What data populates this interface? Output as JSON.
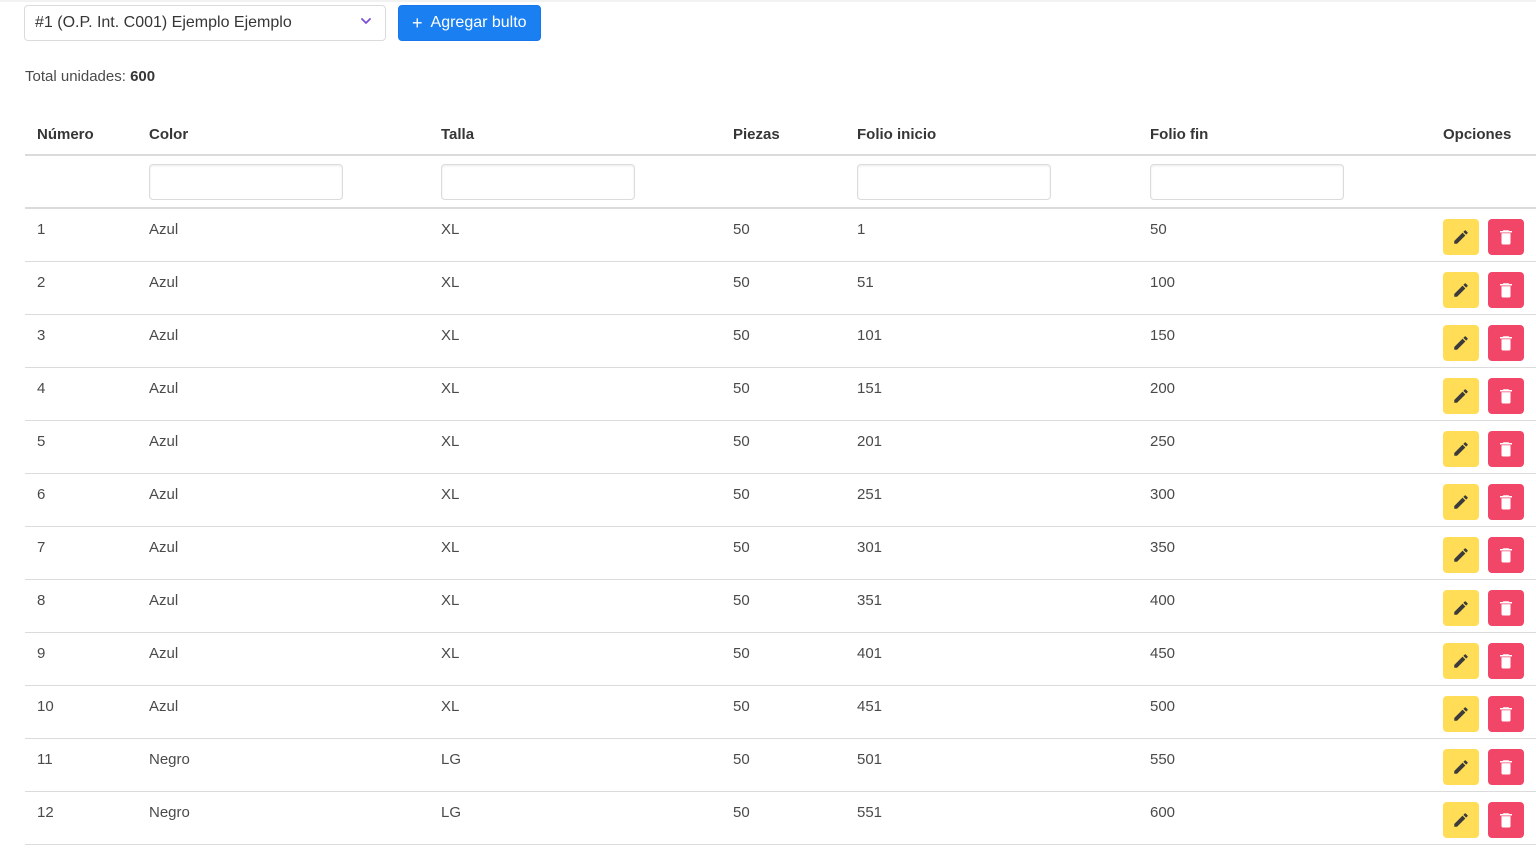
{
  "toolbar": {
    "select_value": "#1 (O.P. Int. C001) Ejemplo Ejemplo",
    "add_label": "Agregar bulto",
    "add_icon": "plus-icon"
  },
  "summary": {
    "total_label": "Total unidades:",
    "total_value": "600"
  },
  "table": {
    "headers": [
      "Número",
      "Color",
      "Talla",
      "Piezas",
      "Folio inicio",
      "Folio fin",
      "Opciones"
    ],
    "rows": [
      {
        "numero": "1",
        "color": "Azul",
        "talla": "XL",
        "piezas": "50",
        "folio_inicio": "1",
        "folio_fin": "50"
      },
      {
        "numero": "2",
        "color": "Azul",
        "talla": "XL",
        "piezas": "50",
        "folio_inicio": "51",
        "folio_fin": "100"
      },
      {
        "numero": "3",
        "color": "Azul",
        "talla": "XL",
        "piezas": "50",
        "folio_inicio": "101",
        "folio_fin": "150"
      },
      {
        "numero": "4",
        "color": "Azul",
        "talla": "XL",
        "piezas": "50",
        "folio_inicio": "151",
        "folio_fin": "200"
      },
      {
        "numero": "5",
        "color": "Azul",
        "talla": "XL",
        "piezas": "50",
        "folio_inicio": "201",
        "folio_fin": "250"
      },
      {
        "numero": "6",
        "color": "Azul",
        "talla": "XL",
        "piezas": "50",
        "folio_inicio": "251",
        "folio_fin": "300"
      },
      {
        "numero": "7",
        "color": "Azul",
        "talla": "XL",
        "piezas": "50",
        "folio_inicio": "301",
        "folio_fin": "350"
      },
      {
        "numero": "8",
        "color": "Azul",
        "talla": "XL",
        "piezas": "50",
        "folio_inicio": "351",
        "folio_fin": "400"
      },
      {
        "numero": "9",
        "color": "Azul",
        "talla": "XL",
        "piezas": "50",
        "folio_inicio": "401",
        "folio_fin": "450"
      },
      {
        "numero": "10",
        "color": "Azul",
        "talla": "XL",
        "piezas": "50",
        "folio_inicio": "451",
        "folio_fin": "500"
      },
      {
        "numero": "11",
        "color": "Negro",
        "talla": "LG",
        "piezas": "50",
        "folio_inicio": "501",
        "folio_fin": "550"
      },
      {
        "numero": "12",
        "color": "Negro",
        "talla": "LG",
        "piezas": "50",
        "folio_inicio": "551",
        "folio_fin": "600"
      }
    ]
  },
  "icons": {
    "edit": "pencil-icon",
    "delete": "trash-icon"
  },
  "colors": {
    "primary": "#1a7ff0",
    "edit": "#ffdd57",
    "delete": "#f14668"
  }
}
